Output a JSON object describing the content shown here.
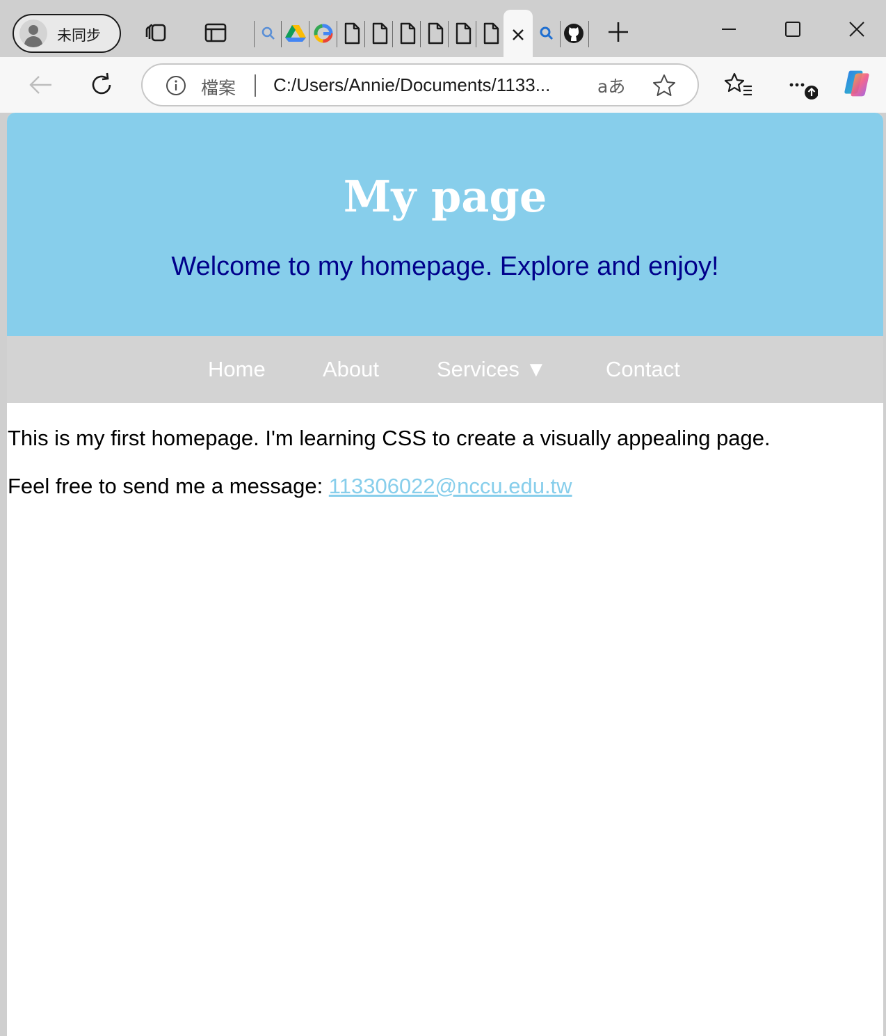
{
  "browser": {
    "profile": {
      "label": "未同步"
    },
    "address": {
      "file_label": "檔案",
      "url": "C:/Users/Annie/Documents/1133...",
      "translate_label": "aあ"
    }
  },
  "page": {
    "title": "My page",
    "subtitle": "Welcome to my homepage. Explore and enjoy!",
    "nav": {
      "home": "Home",
      "about": "About",
      "services": "Services ▼",
      "contact": "Contact"
    },
    "intro": "This is my first homepage. I'm learning CSS to create a visually appealing page.",
    "message_prefix": "Feel free to send me a message: ",
    "email": "113306022@nccu.edu.tw"
  },
  "colors": {
    "header_bg": "#87ceeb",
    "nav_bg": "#d3d3d3",
    "subtitle": "#00008b",
    "link": "#87ceeb"
  }
}
